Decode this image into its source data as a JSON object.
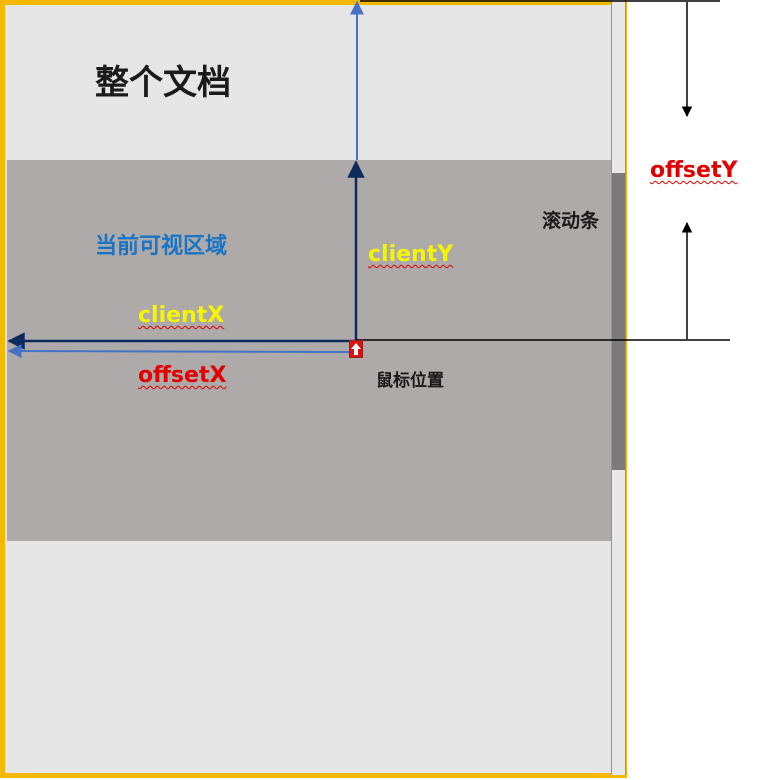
{
  "labels": {
    "whole_document": "整个文档",
    "visible_area": "当前可视区域",
    "scrollbar": "滚动条",
    "mouse_position": "鼠标位置",
    "client_x": "clientX",
    "client_y": "clientY",
    "offset_x": "offsetX",
    "offset_y": "offsetY"
  },
  "colors": {
    "document_border": "#f5b800",
    "document_fill": "#e6e6e6",
    "viewport_fill": "#aeaaaa",
    "client_label": "#f5f500",
    "offset_label": "#e00000",
    "visible_area_label": "#1a74c4",
    "dark_arrow": "#0d2a5c",
    "light_arrow": "#4472c4"
  }
}
